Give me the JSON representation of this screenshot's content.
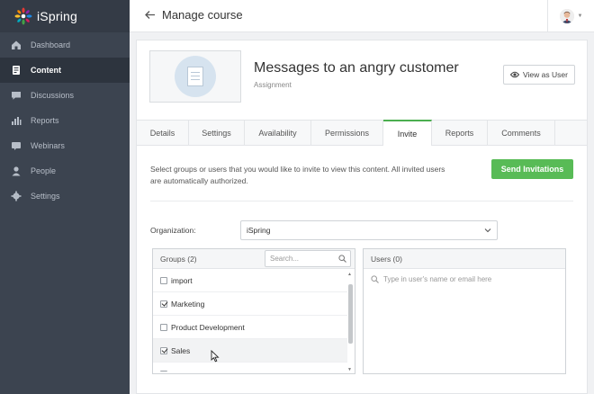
{
  "app": {
    "name": "iSpring"
  },
  "sidebar": {
    "items": [
      {
        "label": "Dashboard",
        "icon": "home-icon",
        "active": false
      },
      {
        "label": "Content",
        "icon": "content-icon",
        "active": true
      },
      {
        "label": "Discussions",
        "icon": "discussions-icon",
        "active": false
      },
      {
        "label": "Reports",
        "icon": "reports-icon",
        "active": false
      },
      {
        "label": "Webinars",
        "icon": "webinars-icon",
        "active": false
      },
      {
        "label": "People",
        "icon": "people-icon",
        "active": false
      },
      {
        "label": "Settings",
        "icon": "settings-icon",
        "active": false
      }
    ]
  },
  "header": {
    "title": "Manage course"
  },
  "content": {
    "title": "Messages to an angry customer",
    "type": "Assignment",
    "view_button": "View as User"
  },
  "tabs": [
    {
      "label": "Details",
      "active": false
    },
    {
      "label": "Settings",
      "active": false
    },
    {
      "label": "Availability",
      "active": false
    },
    {
      "label": "Permissions",
      "active": false
    },
    {
      "label": "Invite",
      "active": true
    },
    {
      "label": "Reports",
      "active": false
    },
    {
      "label": "Comments",
      "active": false
    }
  ],
  "invite": {
    "description": "Select groups or users that you would like to invite to view this content. All invited users are automatically authorized.",
    "send_button": "Send Invitations",
    "organization_label": "Organization:",
    "organization_value": "iSpring",
    "groups_header": "Groups (2)",
    "groups_search_placeholder": "Search...",
    "groups": [
      {
        "label": "import",
        "checked": false
      },
      {
        "label": "Marketing",
        "checked": true
      },
      {
        "label": "Product Development",
        "checked": false
      },
      {
        "label": "Sales",
        "checked": true
      },
      {
        "label": "testHW",
        "checked": false
      }
    ],
    "users_header": "Users (0)",
    "users_search_placeholder": "Type in user's name or email here"
  },
  "colors": {
    "accent": "#58bb56",
    "sidebar": "#3c4450",
    "tab_active": "#4caf50"
  }
}
